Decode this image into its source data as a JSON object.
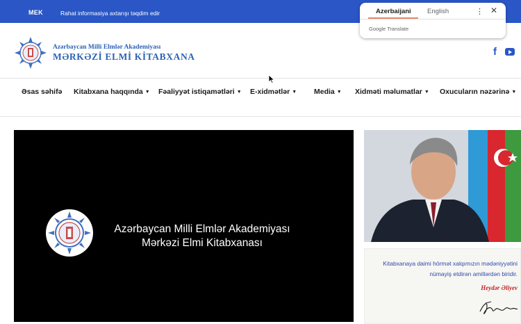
{
  "topbar": {
    "brand": "MEK",
    "description": "Rahat informasiya axtarışı təqdim edir"
  },
  "header": {
    "org_line1": "Azərbaycan Milli Elmlər Akademiyası",
    "org_line2": "MƏRKƏZİ ELMİ KİTABXANA",
    "social": [
      "facebook-icon",
      "youtube-icon"
    ]
  },
  "nav": {
    "items": [
      {
        "label": "Əsas səhifə",
        "dropdown": false
      },
      {
        "label": "Kitabxana haqqında",
        "dropdown": true
      },
      {
        "label": "Fəaliyyət istiqamətləri",
        "dropdown": true
      },
      {
        "label": "E-xidmətlər",
        "dropdown": true
      },
      {
        "label": "Media",
        "dropdown": true
      },
      {
        "label": "Xidməti məlumatlar",
        "dropdown": true
      },
      {
        "label": "Oxucuların nəzərinə",
        "dropdown": true
      }
    ]
  },
  "video": {
    "title_line1": "Azərbaycan Milli Elmlər Akademiyası",
    "title_line2": "Mərkəzi Elmi Kitabxanası"
  },
  "quote": {
    "line1": "Kitabxanaya daimi hörmət xalqımızın mədəniyyətini",
    "line2": "nümayiş etdirən amillərdən biridir.",
    "author": "Heydər Əliyev"
  },
  "translate_popup": {
    "tab_source": "Azerbaijani",
    "tab_target": "English",
    "brand": "Google Translate"
  },
  "colors": {
    "topbar": "#2a56c6",
    "brand_blue": "#2c63b6",
    "quote_red": "#c21f25",
    "quote_blue": "#3049a8"
  }
}
